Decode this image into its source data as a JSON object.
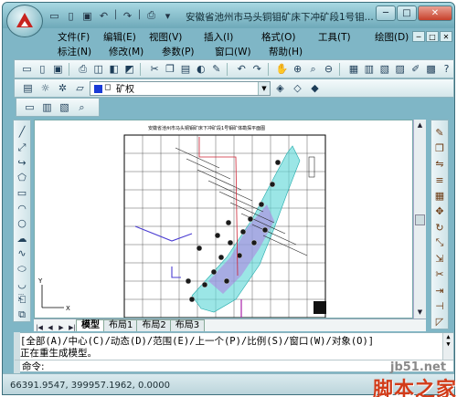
{
  "window": {
    "title": "安徽省池州市马头铜钼矿床下冲矿段1号钼...",
    "controls": [
      "─",
      "□",
      "✕"
    ]
  },
  "quick_access": {
    "buttons": [
      {
        "name": "new",
        "glyph": "▭"
      },
      {
        "name": "open",
        "glyph": "▯"
      },
      {
        "name": "save",
        "glyph": "▣"
      },
      {
        "name": "undo",
        "glyph": "↶"
      },
      {
        "name": "redo",
        "glyph": "↷"
      },
      {
        "name": "plot",
        "glyph": "⎙"
      },
      {
        "name": "dropdown",
        "glyph": "▾"
      }
    ]
  },
  "menubar": {
    "row1": [
      "文件(F)",
      "编辑(E)",
      "视图(V)",
      "插入(I)",
      "格式(O)",
      "工具(T)",
      "绘图(D)"
    ],
    "row2": [
      "标注(N)",
      "修改(M)",
      "参数(P)",
      "窗口(W)",
      "帮助(H)"
    ],
    "mdi_controls": [
      "─",
      "□",
      "✕"
    ]
  },
  "toolbar_standard": {
    "icons": [
      "new-icon",
      "open-icon",
      "save-icon",
      "print-icon",
      "preview-icon",
      "publish-icon",
      "plot-icon",
      "cut-icon",
      "copy-icon",
      "paste-icon",
      "match-icon",
      "brush-icon",
      "undo-icon",
      "redo-icon",
      "pan-icon",
      "zoom-realtime-icon",
      "zoom-window-icon",
      "zoom-previous-icon",
      "properties-icon",
      "designcenter-icon",
      "toolpalette-icon",
      "sheetset-icon",
      "markup-icon",
      "calc-icon",
      "help-icon"
    ],
    "glyphs": [
      "▭",
      "▯",
      "▣",
      "⎙",
      "◫",
      "◧",
      "◩",
      "✂",
      "❐",
      "▤",
      "◐",
      "✎",
      "↶",
      "↷",
      "✋",
      "⊕",
      "⌕",
      "⊖",
      "▦",
      "▥",
      "▧",
      "▨",
      "✐",
      "▩",
      "?"
    ]
  },
  "layer_toolbar": {
    "current_layer": "矿权",
    "layer_color": "#1a3bd6"
  },
  "drawing": {
    "title": "安徽省池州市马头铜钼矿床下冲矿段1号钼矿体勘探平面图"
  },
  "layout_tabs": {
    "nav": [
      "|◀",
      "◀",
      "▶",
      "▶|"
    ],
    "tabs": [
      "模型",
      "布局1",
      "布局2",
      "布局3"
    ],
    "active": "模型"
  },
  "command": {
    "history_line1": "[全部(A)/中心(C)/动态(D)/范围(E)/上一个(P)/比例(S)/窗口(W)/对象(O)]",
    "history_line2": "正在重生成模型。",
    "prompt": "命令:"
  },
  "status": {
    "coordinates": "66391.9547, 399957.1962, 0.0000"
  },
  "watermark": {
    "site": "jb51.net",
    "name": "脚本之家"
  }
}
